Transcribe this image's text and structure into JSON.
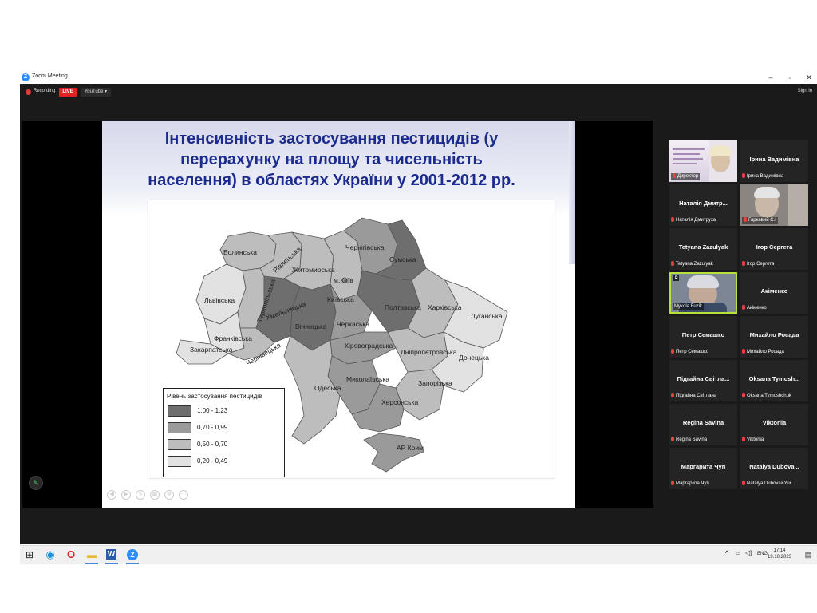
{
  "window": {
    "title": "Zoom Meeting",
    "logo_letter": "Z",
    "min": "–",
    "max": "▫",
    "close": "✕"
  },
  "topbar": {
    "recording": "Recording",
    "live": "LIVE",
    "youtube": "YouTube ▾",
    "sign_in": "Sign in"
  },
  "slide": {
    "title_line1": "Інтенсивність застосування пестицидів (у",
    "title_line2": "перерахунку на площу та чисельність",
    "title_line3": "населення) в областях України у 2001-2012 рр.",
    "legend_title": "Рівень застосування пестицидів",
    "legend": [
      {
        "range": "1,00  -  1,23",
        "color": "#6e6e6e"
      },
      {
        "range": "0,70  -  0,99",
        "color": "#9a9a9a"
      },
      {
        "range": "0,50  -  0,70",
        "color": "#bdbdbd"
      },
      {
        "range": "0,20  -  0,49",
        "color": "#e2e2e2"
      }
    ],
    "regions": {
      "volyn": "Волинська",
      "rivne": "Рівненська",
      "zhytomyr": "Житомирська",
      "chernihiv": "Чернігівська",
      "sumy": "Сумська",
      "lviv": "Львівська",
      "ternopil": "Тернопільська",
      "khmelnytskyi": "Хмельницька",
      "kyiv_city": "м.Київ",
      "kyiv": "Київська",
      "poltava": "Полтавська",
      "kharkiv": "Харківська",
      "luhansk": "Луганська",
      "ivano_frankivsk": "Франківська",
      "vinnytsia": "Вінницька",
      "cherkasy": "Черкаська",
      "zakarpattia": "Закарпатська",
      "chernivtsi": "Чернівецька",
      "kirovohrad": "Кіровоградська",
      "dnipropetrovsk": "Дніпропетровська",
      "donetsk": "Донецька",
      "mykolaiv": "Миколаївська",
      "zaporizhzhia": "Запорізька",
      "odesa": "Одеська",
      "kherson": "Херсонська",
      "crimea": "АР Крим"
    }
  },
  "participants": [
    {
      "name": "",
      "label": "Директор",
      "video": true
    },
    {
      "name": "Ірина Вадимівна",
      "label": "Ірина Вадимівна",
      "video": false
    },
    {
      "name": "Наталія Дмитр...",
      "label": "Наталія Дмитруха",
      "video": false
    },
    {
      "name": "",
      "label": "Гаркавий С.І",
      "video": true
    },
    {
      "name": "Tetyana Zazulyak",
      "label": "Tetyana Zazulyak",
      "video": false
    },
    {
      "name": "Ігор Сергета",
      "label": "Ігор Сергета",
      "video": false
    },
    {
      "name": "",
      "label": "Mykola Fuzik",
      "video": true
    },
    {
      "name": "Акіменко",
      "label": "Акіменко",
      "video": false
    },
    {
      "name": "Петр Семашко",
      "label": "Петр Семашко",
      "video": false
    },
    {
      "name": "Михайло Росада",
      "label": "Михайло Росада",
      "video": false
    },
    {
      "name": "Підгайна Світла...",
      "label": "Підгайна Світлана",
      "video": false
    },
    {
      "name": "Oksana Tymosh...",
      "label": "Oksana Tymoshchuk",
      "video": false
    },
    {
      "name": "Regina Savina",
      "label": "Regina Savina",
      "video": false
    },
    {
      "name": "Viktoriia",
      "label": "Viktoriia",
      "video": false
    },
    {
      "name": "Маргарита Чуп",
      "label": "Маргарита Чуп",
      "video": false
    },
    {
      "name": "Natalya Dubova...",
      "label": "Natalya Dubova&Yur...",
      "video": false
    }
  ],
  "taskbar": {
    "lang": "ENG",
    "time": "17:14",
    "date": "19.10.2023"
  }
}
